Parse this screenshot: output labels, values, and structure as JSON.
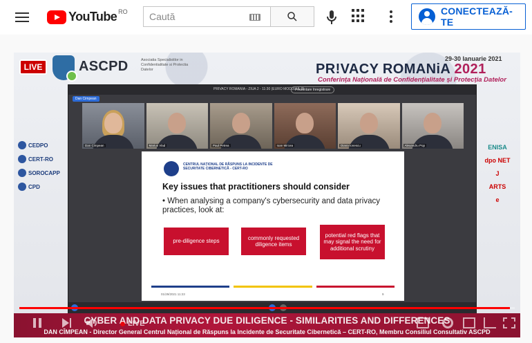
{
  "header": {
    "logo_text": "YouTube",
    "region": "RO",
    "search_placeholder": "Caută",
    "signin_label": "CONECTEAZĂ-TE"
  },
  "video": {
    "live_badge": "LIVE",
    "org_name": "ASCPD",
    "org_subtitle": "Asociatia Specialistilor in Confidentialitate si Protectia Datelor",
    "event_dates": "29-30 Ianuarie 2021",
    "event_title": "PR!VACY ROMANiA",
    "event_year": "2021",
    "event_subtitle": "Conferința Națională de Confidențialitate și Protecția Datelor",
    "sponsors_left": [
      "CEDPO",
      "CERT-RO",
      "SOROCAPP",
      "CPD"
    ],
    "sponsors_right": [
      "ENISA",
      "dpo NET",
      "J",
      "ARTS",
      "e"
    ],
    "meeting": {
      "title": "PRIVACY ROMANIA - ZIUA 2 - 11:30 (EURO MODULUL 3)",
      "presenting_label": "Prezentare înregistrare",
      "chip": "Dan Cimpean",
      "participants": [
        "Dan Cimpean",
        "Marius Vlad",
        "Paul Petrea",
        "Ioan Mircea",
        "Diana Ionescu",
        "Alexandru Pop"
      ]
    },
    "slide": {
      "org": "CENTRUL NAȚIONAL DE RĂSPUNS LA INCIDENTE DE SECURITATE CIBERNETICĂ - CERT-RO",
      "heading": "Key issues that practitioners should consider",
      "bullet": "• When analysing a company's cybersecurity and data privacy practices, look at:",
      "boxes": [
        "pre-diligence steps",
        "commonly requested diligence items",
        "potential red flags that may signal the need for additional scrutiny"
      ],
      "bar_colors": [
        "#1e3f8a",
        "#f2c300",
        "#c8102e"
      ],
      "date": "01/29/2021 11:23",
      "page": "9"
    },
    "lower_title": "CYBER AND DATA PRIVACY DUE DILIGENCE - SIMILARITIES AND DIFFERENCES",
    "lower_subtitle": "DAN CÎMPEAN - Director General Centrul Național de Răspuns la Incidente de Securitate Cibernetică – CERT-RO, Membru Consiliul Consultativ ASCPD",
    "player": {
      "live_label": "LIVE",
      "progress_fraction": 0.99
    }
  }
}
